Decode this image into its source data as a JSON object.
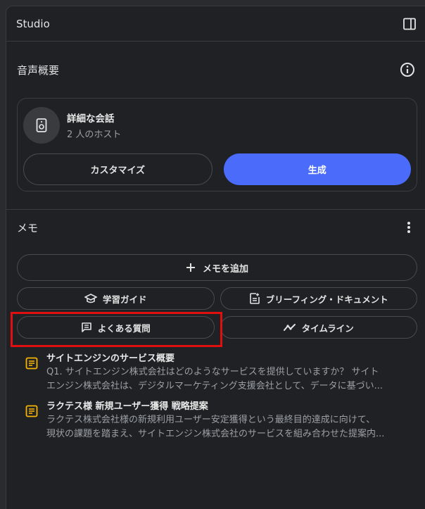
{
  "header": {
    "title": "Studio",
    "panel_icon": "panel-toggle-icon"
  },
  "audio": {
    "section_title": "音声概要",
    "info_icon": "info-icon",
    "card": {
      "title": "詳細な会話",
      "subtitle": "2 人のホスト",
      "speaker_icon": "speaker-icon",
      "customize_label": "カスタマイズ",
      "generate_label": "生成"
    }
  },
  "memo": {
    "section_title": "メモ",
    "more_icon": "more-vert-icon",
    "add_label": "メモを追加",
    "buttons": [
      {
        "label": "学習ガイド",
        "icon": "graduation-cap-icon"
      },
      {
        "label": "ブリーフィング・ドキュメント",
        "icon": "document-add-icon"
      },
      {
        "label": "よくある質問",
        "icon": "faq-icon"
      },
      {
        "label": "タイムライン",
        "icon": "timeline-icon"
      }
    ],
    "notes": [
      {
        "title": "サイトエンジンのサービス概要",
        "line1": "Q1. サイトエンジン株式会社はどのようなサービスを提供していますか？ サイト",
        "line2": "エンジン株式会社は、デジタルマーケティング支援会社として、データに基づい..."
      },
      {
        "title": "ラクテス様 新規ユーザー獲得 戦略提案",
        "line1": "ラクテス株式会社様の新規利用ユーザー安定獲得という最終目的達成に向けて、",
        "line2": "現状の課題を踏まえ、サイトエンジン株式会社のサービスを組み合わせた提案内..."
      }
    ]
  },
  "colors": {
    "accent": "#4b6bfb",
    "highlight": "#e01010",
    "note_icon": "#f6b400"
  }
}
